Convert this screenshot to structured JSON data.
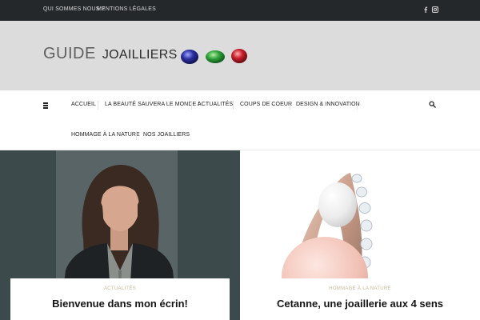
{
  "topbar": {
    "links": [
      "QUI SOMMES NOUS ?",
      "MENTIONS LÉGALES"
    ],
    "social": [
      "facebook-icon",
      "instagram-icon"
    ]
  },
  "header": {
    "logo_word1": "GUIDE",
    "logo_word2": "JOAILLIERS",
    "gem_colors": [
      "#2b2fa0",
      "#2fa23a",
      "#c81e2a"
    ]
  },
  "nav": {
    "items": [
      "ACCUEIL",
      "LA BEAUTÉ SAUVERA LE MONDE !",
      "ACTUALITÉS",
      "COUPS DE COEUR",
      "DESIGN & INNOVATION",
      "HOMMAGE À LA NATURE",
      "NOS JOAILLIERS"
    ]
  },
  "articles": [
    {
      "category": "ACTUALITÉS",
      "title": "Bienvenue dans mon écrin!"
    },
    {
      "category": "HOMMAGE À LA NATURE",
      "title": "Cetanne, une joaillerie aux 4 sens"
    }
  ]
}
